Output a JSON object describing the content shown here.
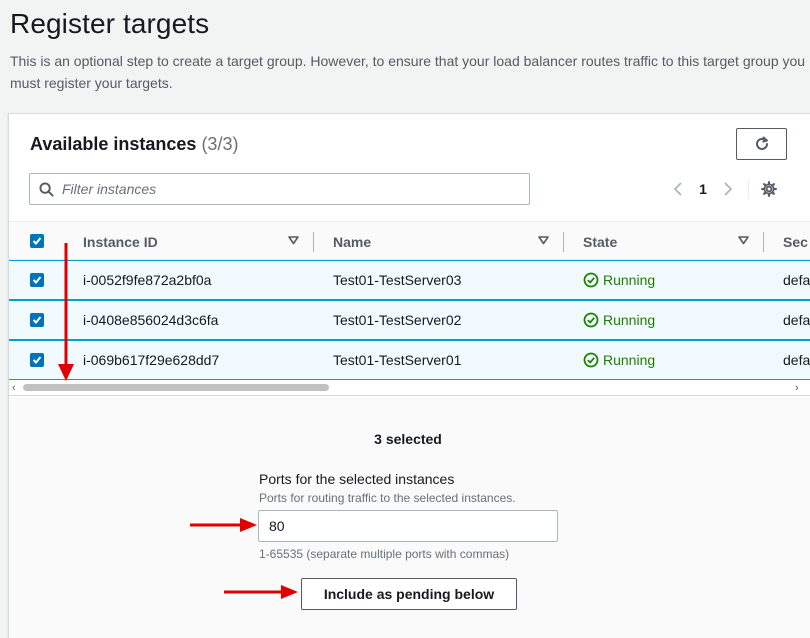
{
  "page": {
    "title": "Register targets",
    "description": "This is an optional step to create a target group. However, to ensure that your load balancer routes traffic to this target group you must register your targets."
  },
  "panel": {
    "title": "Available instances",
    "count": "(3/3)",
    "refresh_icon": "refresh-icon",
    "search_placeholder": "Filter instances",
    "page_number": "1"
  },
  "table": {
    "columns": [
      "Instance ID",
      "Name",
      "State",
      "Sec"
    ],
    "header_checkbox_checked": true,
    "rows": [
      {
        "instance_id": "i-0052f9fe872a2bf0a",
        "name": "Test01-TestServer03",
        "state": "Running",
        "sec": "defa",
        "checked": true
      },
      {
        "instance_id": "i-0408e856024d3c6fa",
        "name": "Test01-TestServer02",
        "state": "Running",
        "sec": "defa",
        "checked": true
      },
      {
        "instance_id": "i-069b617f29e628dd7",
        "name": "Test01-TestServer01",
        "state": "Running",
        "sec": "defa",
        "checked": true
      }
    ]
  },
  "selection": {
    "summary": "3 selected",
    "ports_label": "Ports for the selected instances",
    "ports_description": "Ports for routing traffic to the selected instances.",
    "ports_value": "80",
    "ports_hint": "1-65535 (separate multiple ports with commas)",
    "include_button": "Include as pending below"
  },
  "colors": {
    "accent": "#0073bb",
    "running": "#1d8102",
    "annotation": "#e00000",
    "selected_row_bg": "#f1faff"
  }
}
